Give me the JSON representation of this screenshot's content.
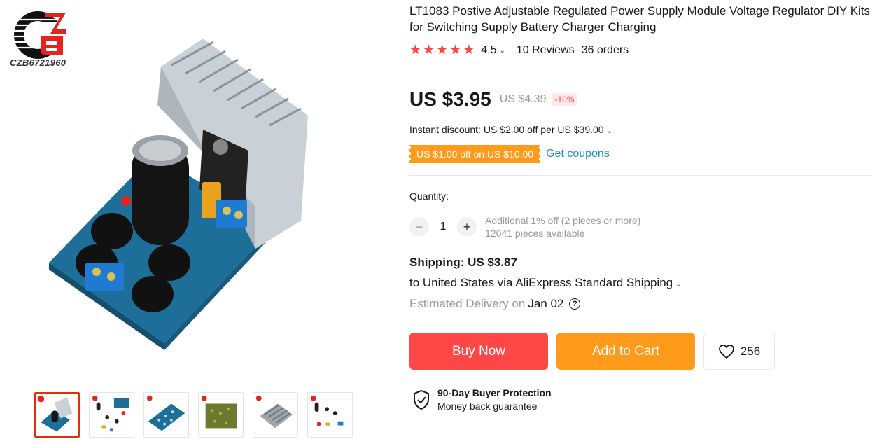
{
  "store": {
    "logo_text": "CZB6721960"
  },
  "gallery": {
    "thumbnails": [
      "thumb-1",
      "thumb-2",
      "thumb-3",
      "thumb-4",
      "thumb-5",
      "thumb-6"
    ],
    "active_index": 0
  },
  "product": {
    "title": "LT1083 Postive Adjustable Regulated Power Supply Module Voltage Regulator DIY Kits for Switching Supply Battery Charger Charging",
    "rating": "4.5",
    "stars": 5,
    "reviews": "10 Reviews",
    "orders": "36 orders"
  },
  "price": {
    "current": "US $3.95",
    "original": "US $4.39",
    "discount": "-10%"
  },
  "promotions": {
    "instant_discount": "Instant discount: US $2.00 off per US $39.00",
    "coupon": "US $1.00 off on US $10.00",
    "get_coupons": "Get coupons"
  },
  "quantity": {
    "label": "Quantity:",
    "value": "1",
    "minus": "−",
    "plus": "+",
    "additional": "Additional 1% off (2 pieces or more)",
    "available": "12041 pieces available"
  },
  "shipping": {
    "title": "Shipping: US $3.87",
    "route": "to United States via AliExpress Standard Shipping",
    "estimate_label": "Estimated Delivery on",
    "estimate_date": "Jan 02"
  },
  "actions": {
    "buy_now": "Buy Now",
    "add_to_cart": "Add to Cart",
    "wishlist_count": "256"
  },
  "protection": {
    "title": "90-Day Buyer Protection",
    "subtitle": "Money back guarantee"
  },
  "colors": {
    "accent_red": "#ff4747",
    "accent_orange": "#ff9a1a",
    "link_blue": "#1a8dd1",
    "star_red": "#ff4444"
  }
}
